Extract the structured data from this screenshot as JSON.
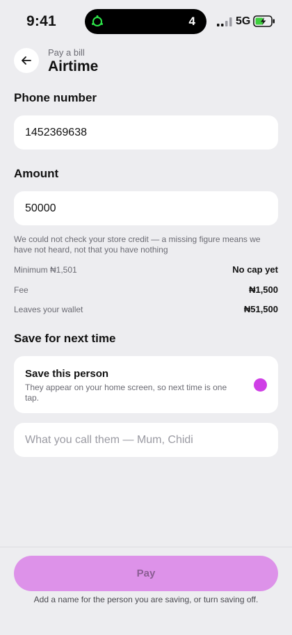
{
  "status_bar": {
    "time": "9:41",
    "island_count": "4",
    "network": "5G",
    "island_icon": "activity-ring-icon",
    "signal_icon": "cellular-signal-icon",
    "battery_icon": "battery-charging-icon"
  },
  "header": {
    "subtitle": "Pay a bill",
    "title": "Airtime",
    "back_icon": "arrow-left-icon"
  },
  "phone": {
    "label": "Phone number",
    "value": "1452369638"
  },
  "amount": {
    "label": "Amount",
    "value": "50000",
    "note": "We could not check your store credit — a missing figure means we have not heard, not that you have nothing"
  },
  "summary": [
    {
      "label": "Minimum ₦1,501",
      "value": "No cap yet"
    },
    {
      "label": "Fee",
      "value": "₦1,500"
    },
    {
      "label": "Leaves your wallet",
      "value": "₦51,500"
    }
  ],
  "save": {
    "section_label": "Save for next time",
    "title": "Save this person",
    "description": "They appear on your home screen, so next time is one tap.",
    "name_placeholder": "What you call them — Mum, Chidi",
    "name_value": ""
  },
  "footer": {
    "pay_label": "Pay",
    "hint": "Add a name for the person you are saving, or turn saving off."
  },
  "colors": {
    "background": "#ededf0",
    "accent": "#cf3fe6",
    "pay_button": "#dd92e9",
    "battery_green": "#3ecf3e",
    "island_ring": "#2ee84a"
  }
}
